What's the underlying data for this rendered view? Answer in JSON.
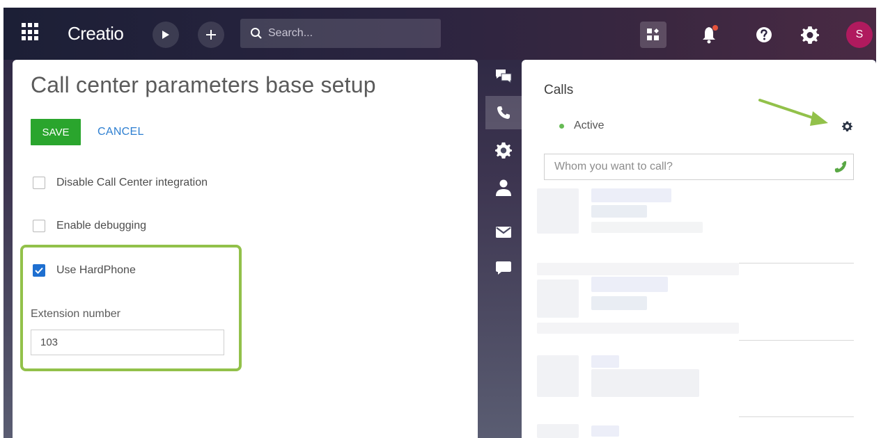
{
  "topbar": {
    "logo": "Creatio",
    "search_placeholder": "Search...",
    "avatar_initial": "S",
    "icons": [
      "apps-grid-icon",
      "play-icon",
      "plus-icon",
      "search-icon",
      "widgets-icon",
      "bell-icon",
      "help-icon",
      "gear-icon"
    ],
    "notification_dot_color": "#e5533c"
  },
  "left_panel": {
    "title": "Call center parameters base setup",
    "save_label": "SAVE",
    "cancel_label": "CANCEL",
    "checkboxes": [
      {
        "label": "Disable Call Center integration",
        "checked": false
      },
      {
        "label": "Enable debugging",
        "checked": false
      },
      {
        "label": "Use HardPhone",
        "checked": true
      }
    ],
    "extension_label": "Extension number",
    "extension_value": "103",
    "highlight_color": "#92c14a"
  },
  "strip": {
    "items": [
      "chat-feed-icon",
      "phone-icon",
      "settings-icon",
      "contact-icon",
      "email-icon",
      "message-icon"
    ],
    "active_index": 1
  },
  "right_panel": {
    "title": "Calls",
    "status": "Active",
    "status_color": "#66bb55",
    "call_placeholder": "Whom you want to call?",
    "phone_icon_color": "#5aa845",
    "arrow_color": "#92c14a"
  },
  "colors": {
    "save_button": "#2aa52d",
    "cancel_link": "#2e7fd1",
    "checkbox_checked": "#1e6fd0",
    "avatar": "#b01a5e"
  }
}
